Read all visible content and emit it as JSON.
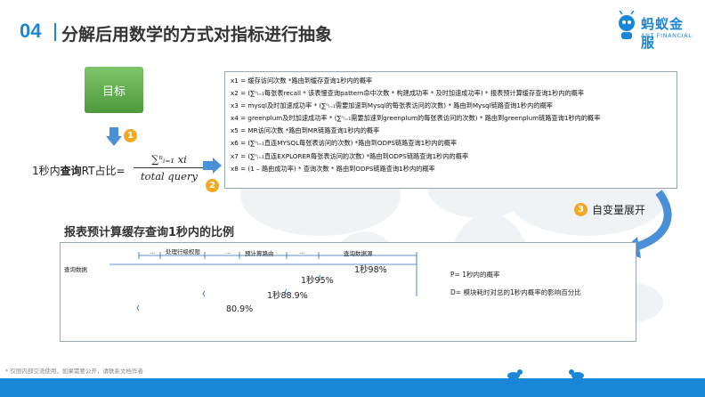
{
  "header": {
    "number": "04",
    "title": "分解后用数学的方式对指标进行抽象"
  },
  "logo": {
    "cn": "蚂蚁金服",
    "en": "ANT FINANCIAL"
  },
  "left": {
    "target": "目标",
    "badge1": "1",
    "badge2": "2",
    "ratio_prefix": "1秒内",
    "ratio_bold": "查询",
    "ratio_suffix": "RT占比=",
    "numerator": "∑ⁿᵢ₌₁ xi",
    "denominator": "total query"
  },
  "formulas": [
    "x1 = 缓存访问次数 *路由到缓存查询1秒内的概率",
    "x2 = (∑ⁿᵢ₌₁每张表recall * 该表慢查询pattern命中次数 * 构建成功率 * 及时加速成功率) * 报表预计算缓存查询1秒内的概率",
    "x3 = mysql及时加速成功率 * (∑ⁿᵢ₌₁需要加速到Mysql的每张表访问的次数) * 路由到Mysql链路查询1秒内的概率",
    "x4 = greenplum及时加速成功率 * (∑ⁿᵢ₌₁需要加速到greenplum的每张表访问的次数) * 路由到greenplum链路查询1秒内的概率",
    "x5 = MR访问次数 *路由到MR链路查询1秒内的概率",
    "x6 = (∑ⁿᵢ₌₁直连MYSQL每张表访问的次数) *路由到ODPS链路查询1秒内的概率",
    "x7 = (∑ⁿᵢ₌₁直连EXPLORER每张表访问的次数) *路由到ODPS链路查询1秒内的概率",
    "x8 = (1 – 路由成功率) * 查询次数 * 路由到ODPS链路查询1秒内的概率"
  ],
  "expand": {
    "badge": "3",
    "label": "自变量展开"
  },
  "section": {
    "title": "报表预计算缓存查询1秒内的比例"
  },
  "timeline": {
    "row_label": "查询数据",
    "segments": [
      "...",
      "处理行级权限",
      "...",
      "预计算路由",
      "...",
      "查询数据源"
    ],
    "values": [
      "1秒98%",
      "1秒95%",
      "1秒88.9%",
      "80.9%"
    ],
    "legend_p": "P= 1秒内的概率",
    "legend_d": "D= 模块耗时对总的1秒内概率的影响百分比"
  },
  "footer": {
    "note": "* 仅限内部交流使用，如果需要公开，请联系文档作者"
  },
  "colors": {
    "accent": "#1a86d8",
    "target_green": "#5aa846",
    "badge_orange": "#f3a81f",
    "arrow_blue": "#4a90d9"
  }
}
